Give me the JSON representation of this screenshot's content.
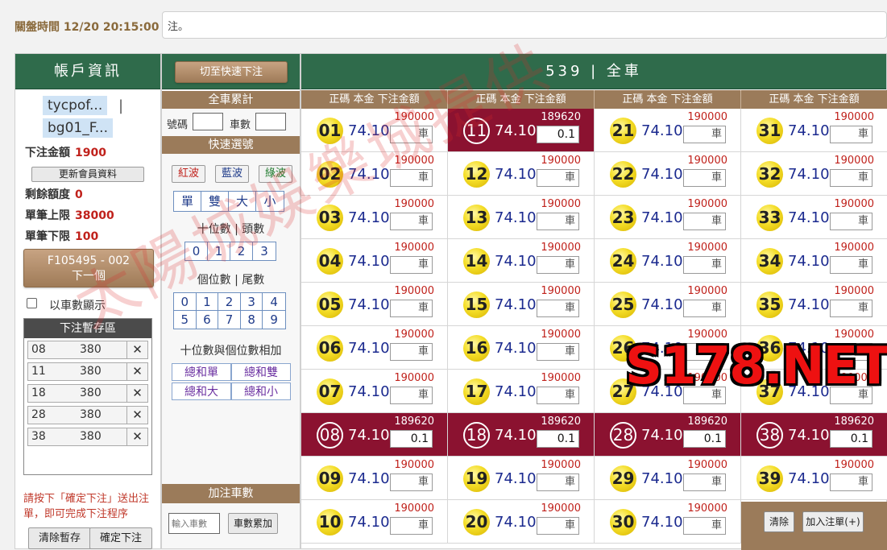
{
  "topbar": {
    "close_time_label": "關盤時間 12/20 20:15:00",
    "notice": "注。"
  },
  "account": {
    "title": "帳戶資訊",
    "user_tag_1": "tycpof...",
    "user_sep": "|",
    "user_tag_2": "bg01_F...",
    "bet_amount_label": "下注金額",
    "bet_amount": "1900",
    "update_button": "更新會員資料",
    "remaining_label": "剩餘額度",
    "remaining": "0",
    "max_label": "單筆上限",
    "max": "38000",
    "min_label": "單筆下限",
    "min": "100",
    "next_button_line1": "F105495 - 002",
    "next_button_line2": "下一個",
    "show_by_car_label": "以車數顯示",
    "pending_title": "下注暫存區",
    "pending_items": [
      {
        "num": "08",
        "amount": "380"
      },
      {
        "num": "11",
        "amount": "380"
      },
      {
        "num": "18",
        "amount": "380"
      },
      {
        "num": "28",
        "amount": "380"
      },
      {
        "num": "38",
        "amount": "380"
      }
    ],
    "hint": "請按下「確定下注」送出注單，即可完成下注程序",
    "clear_button": "清除暫存",
    "confirm_button": "確定下注"
  },
  "middle": {
    "quick_switch_button": "切至快速下注",
    "total_title": "全車累計",
    "num_label": "號碼",
    "car_label": "車數",
    "quick_title": "快速選號",
    "waves": [
      "紅波",
      "藍波",
      "綠波"
    ],
    "odd_even": [
      "單",
      "雙",
      "大",
      "小"
    ],
    "tens_label": "十位數 | 頭數",
    "tens": [
      "0",
      "1",
      "2",
      "3"
    ],
    "units_label": "個位數 | 尾數",
    "units": [
      "0",
      "1",
      "2",
      "3",
      "4",
      "5",
      "6",
      "7",
      "8",
      "9"
    ],
    "sum_label": "十位數與個位數相加",
    "sum_buttons": [
      "總和單",
      "總和雙",
      "總和大",
      "總和小"
    ],
    "add_title": "加注車數",
    "add_input_placeholder": "輸入車數",
    "add_button": "車數累加"
  },
  "grid": {
    "title": "539 | 全車",
    "col_header": "正碼  本金  下注金額",
    "rate": "74.10",
    "default_limit": "190000",
    "selected_limit": "189620",
    "placeholder": "車",
    "selected_value": "0.1",
    "numbers": [
      [
        "01",
        "11",
        "21",
        "31"
      ],
      [
        "02",
        "12",
        "22",
        "32"
      ],
      [
        "03",
        "13",
        "23",
        "33"
      ],
      [
        "04",
        "14",
        "24",
        "34"
      ],
      [
        "05",
        "15",
        "25",
        "35"
      ],
      [
        "06",
        "16",
        "26",
        "36"
      ],
      [
        "07",
        "17",
        "27",
        "37"
      ],
      [
        "08",
        "18",
        "28",
        "38"
      ],
      [
        "09",
        "19",
        "29",
        "39"
      ],
      [
        "10",
        "20",
        "30",
        ""
      ]
    ],
    "selected": [
      "08",
      "11",
      "18",
      "28",
      "38"
    ],
    "clear_button": "清除",
    "add_order_button": "加入注單(+)"
  },
  "watermark": {
    "text": "太陽城娛樂城提供",
    "brand": "S178.NET"
  },
  "colors": {
    "header_green": "#2f6b4b",
    "selected_red": "#8b1230",
    "brown": "#9b7b5a"
  }
}
